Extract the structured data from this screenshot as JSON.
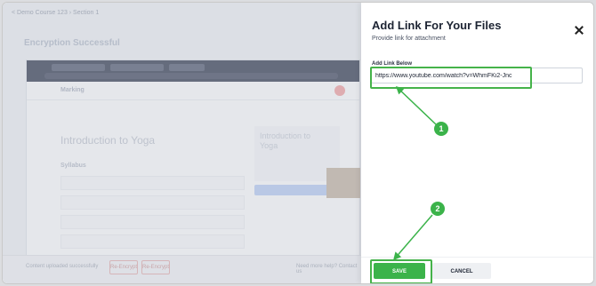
{
  "background": {
    "breadcrumb": "< Demo Course 123 › Section 1",
    "page_title": "Encryption Successful",
    "course_title": "Introduction to Yoga",
    "card_title": "Introduction to Yoga",
    "syllabus_label": "Syllabus",
    "footer_text": "Content uploaded successfully",
    "footer_btn1": "Re-Encrypt",
    "footer_btn2": "Re-Encrypt",
    "footer_right": "Need more help? Contact us"
  },
  "panel": {
    "title": "Add Link For Your Files",
    "subtitle": "Provide link for attachment",
    "field_label": "Add Link Below",
    "link_value": "https://www.youtube.com/watch?v=WhmFKi2-Jnc",
    "save_label": "SAVE",
    "cancel_label": "CANCEL"
  },
  "markers": {
    "step1": "1",
    "step2": "2"
  },
  "colors": {
    "accent_green": "#3bb34a",
    "title_text": "#1d2433"
  },
  "icons": {
    "close": "close-icon"
  }
}
